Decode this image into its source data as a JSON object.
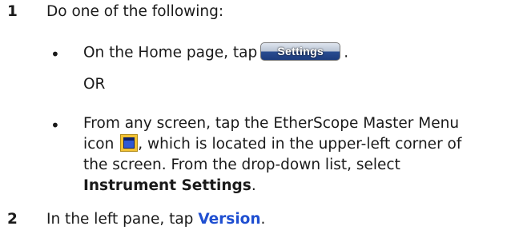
{
  "step1": {
    "number": "1",
    "text": "Do one of the following:"
  },
  "bullet1": {
    "symbol": "•",
    "text_before": "On the Home page, tap",
    "button_label": "Settings",
    "text_after": "."
  },
  "or_text": "OR",
  "bullet2": {
    "symbol": "•",
    "line1": "From any screen, tap the EtherScope Master Menu",
    "line2_before_icon": "icon",
    "line2_after_icon": ", which is located in the upper-left corner of",
    "line3": "the screen. From the drop-down list, select",
    "line4_bold": "Instrument Settings",
    "line4_after": "."
  },
  "step2": {
    "number": "2",
    "text_before": "In the left pane, tap",
    "link_text": "Version",
    "text_after": "."
  },
  "colors": {
    "link": "#1f4fd1",
    "button_top": "#b8c3d3",
    "button_bottom": "#1c3b7c",
    "icon_frame": "#f2c233",
    "icon_screen": "#2f58d3"
  },
  "icons": {
    "master_menu": "etherscope-master-menu-icon"
  }
}
